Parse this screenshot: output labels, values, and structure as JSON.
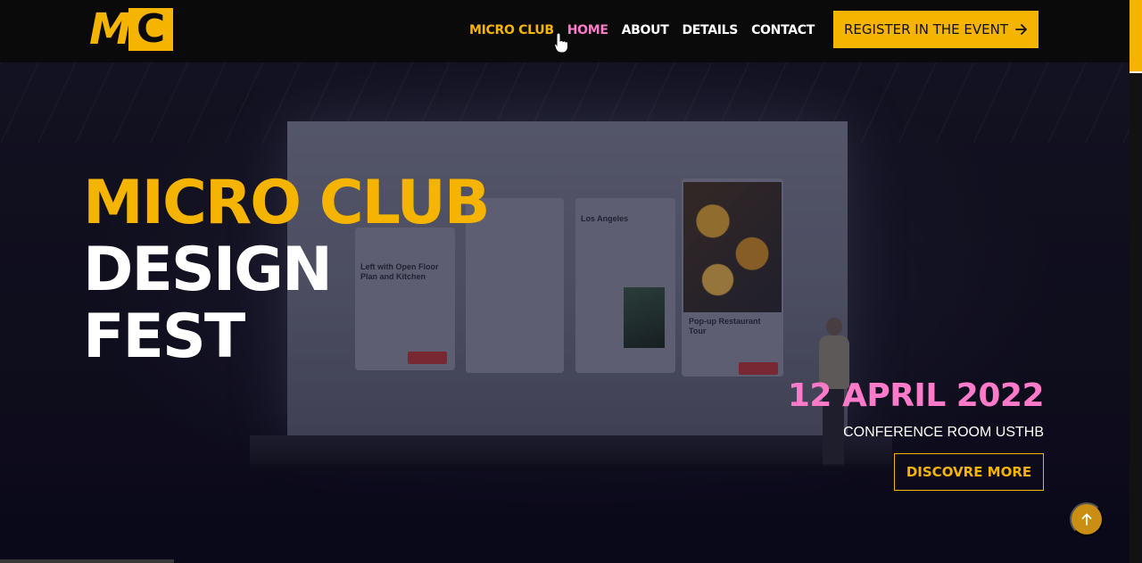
{
  "header": {
    "logo_text": "MC",
    "nav": [
      {
        "label": "MICRO CLUB"
      },
      {
        "label": "HOME"
      },
      {
        "label": "ABOUT"
      },
      {
        "label": "DETAILS"
      },
      {
        "label": "CONTACT"
      }
    ],
    "register_label": "REGISTER IN THE EVENT",
    "register_icon": "arrow-right-icon"
  },
  "hero": {
    "title_line_1": "MICRO CLUB",
    "title_line_2": "DESIGN",
    "title_line_3": "FEST",
    "date": "12 APRIL 2022",
    "venue": "CONFERENCE ROOM USTHB",
    "discover_label": "DISCOVRE MORE"
  },
  "screen_mock": {
    "card_title_1": "Left with Open Floor Plan and Kitchen",
    "city": "Los Angeles",
    "tour": "Pop-up Restaurant Tour"
  },
  "scroll_top_icon": "arrow-up-icon",
  "colors": {
    "accent": "#f5b400",
    "pink": "#ff7ac8",
    "header_bg": "#0a0a0a"
  }
}
